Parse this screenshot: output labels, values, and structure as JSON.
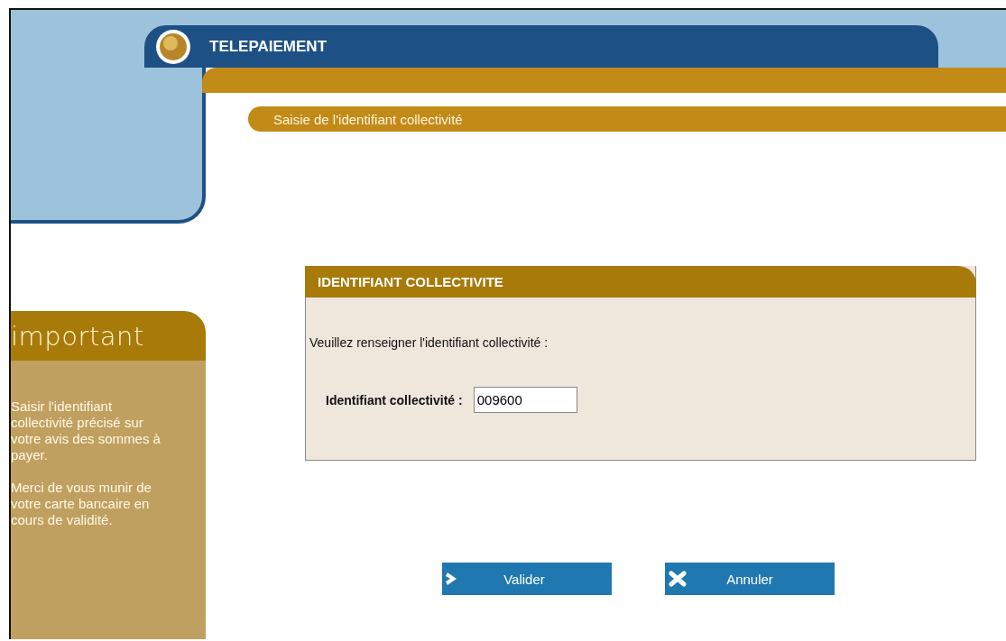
{
  "header": {
    "title": "TELEPAIEMENT",
    "subtitle": "Saisie de l'identifiant collectivité"
  },
  "sidebar": {
    "title": "important",
    "paragraphs": [
      "Saisir l'identifiant collectivité précisé sur votre avis des sommes à payer.",
      "Merci de vous munir de votre carte bancaire en cours de validité."
    ]
  },
  "panel": {
    "title": "IDENTIFIANT COLLECTIVITE",
    "instruction": "Veuillez renseigner l'identifiant collectivité :",
    "field": {
      "label": "Identifiant collectivité :",
      "value": "009600"
    }
  },
  "buttons": [
    {
      "label": "Valider",
      "kind": "submit"
    },
    {
      "label": "Annuler",
      "kind": "cancel"
    }
  ]
}
